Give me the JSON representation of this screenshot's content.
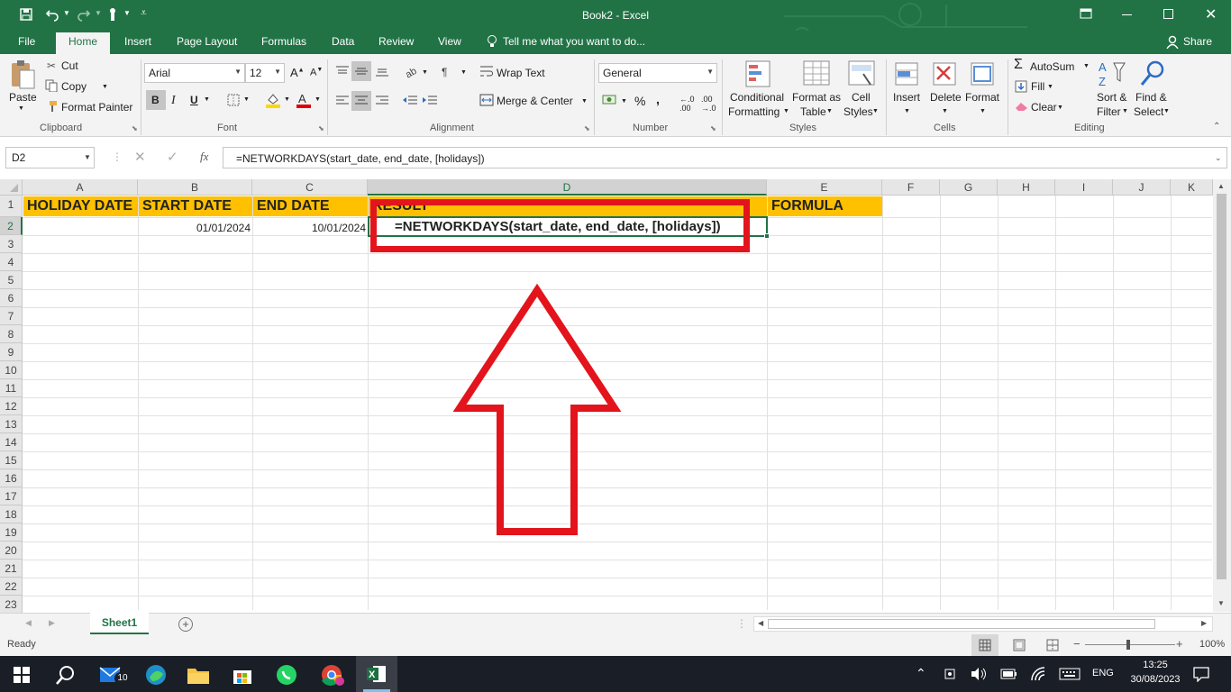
{
  "window": {
    "title": "Book2 - Excel"
  },
  "qat": {
    "save_icon": "save-icon",
    "undo_icon": "undo-icon",
    "redo_icon": "redo-icon",
    "touch_icon": "touch-mode-icon"
  },
  "tabs": [
    "File",
    "Home",
    "Insert",
    "Page Layout",
    "Formulas",
    "Data",
    "Review",
    "View"
  ],
  "tell_me": "Tell me what you want to do...",
  "share": "Share",
  "ribbon": {
    "clipboard": {
      "paste": "Paste",
      "cut": "Cut",
      "copy": "Copy",
      "format_painter": "Format Painter",
      "label": "Clipboard"
    },
    "font": {
      "name": "Arial",
      "size": "12",
      "bold": "B",
      "italic": "I",
      "underline": "U",
      "label": "Font"
    },
    "alignment": {
      "wrap_text": "Wrap Text",
      "merge_center": "Merge & Center",
      "label": "Alignment"
    },
    "number": {
      "format": "General",
      "percent": "%",
      "comma": ",",
      "label": "Number"
    },
    "styles": {
      "conditional_1": "Conditional",
      "conditional_2": "Formatting",
      "format_table_1": "Format as",
      "format_table_2": "Table",
      "cell_styles_1": "Cell",
      "cell_styles_2": "Styles",
      "label": "Styles"
    },
    "cells": {
      "insert": "Insert",
      "delete": "Delete",
      "format": "Format",
      "label": "Cells"
    },
    "editing": {
      "autosum": "AutoSum",
      "fill": "Fill",
      "clear": "Clear",
      "sort_1": "Sort &",
      "sort_2": "Filter",
      "find_1": "Find &",
      "find_2": "Select",
      "label": "Editing"
    }
  },
  "formula_bar": {
    "name_box": "D2",
    "fx": "fx",
    "formula": "=NETWORKDAYS(start_date, end_date, [holidays])"
  },
  "columns": [
    "A",
    "B",
    "C",
    "D",
    "E",
    "F",
    "G",
    "H",
    "I",
    "J",
    "K"
  ],
  "rows": [
    "1",
    "2",
    "3",
    "4",
    "5",
    "6",
    "7",
    "8",
    "9",
    "10",
    "11",
    "12",
    "13",
    "14",
    "15",
    "16",
    "17",
    "18",
    "19",
    "20",
    "21",
    "22",
    "23"
  ],
  "cells": {
    "A1": "HOLIDAY DATE",
    "B1": "START DATE",
    "C1": "END DATE",
    "D1": "RESULT",
    "E1": "FORMULA",
    "B2": "01/01/2024",
    "C2": "10/01/2024",
    "D2": "=NETWORKDAYS(start_date, end_date, [holidays])"
  },
  "colors": {
    "excel_green": "#217346",
    "header_fill": "#ffc000",
    "annotation_red": "#e3141c"
  },
  "sheet_tab": "Sheet1",
  "status": {
    "ready": "Ready",
    "zoom": "100%"
  },
  "taskbar": {
    "mail_badge": "10",
    "language": "ENG",
    "time": "13:25",
    "date": "30/08/2023"
  }
}
